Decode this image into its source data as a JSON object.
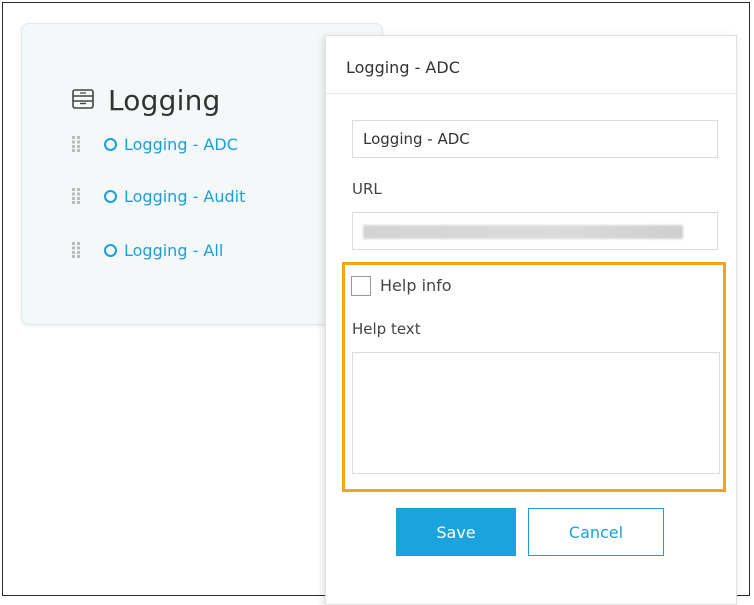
{
  "card": {
    "icon": "inbox-icon",
    "title": "Logging",
    "items": [
      {
        "label": "Logging - ADC"
      },
      {
        "label": "Logging - Audit"
      },
      {
        "label": "Logging - All"
      }
    ]
  },
  "dialog": {
    "title": "Logging - ADC",
    "name_value": "Logging - ADC",
    "url_label": "URL",
    "url_value": "",
    "help_info_label": "Help info",
    "help_info_checked": false,
    "help_text_label": "Help text",
    "help_text_value": "",
    "save_label": "Save",
    "cancel_label": "Cancel"
  },
  "colors": {
    "accent": "#1aa3dc",
    "link": "#1a9fd8",
    "highlight": "#f5a31a",
    "card_bg": "#f5f8f9"
  }
}
